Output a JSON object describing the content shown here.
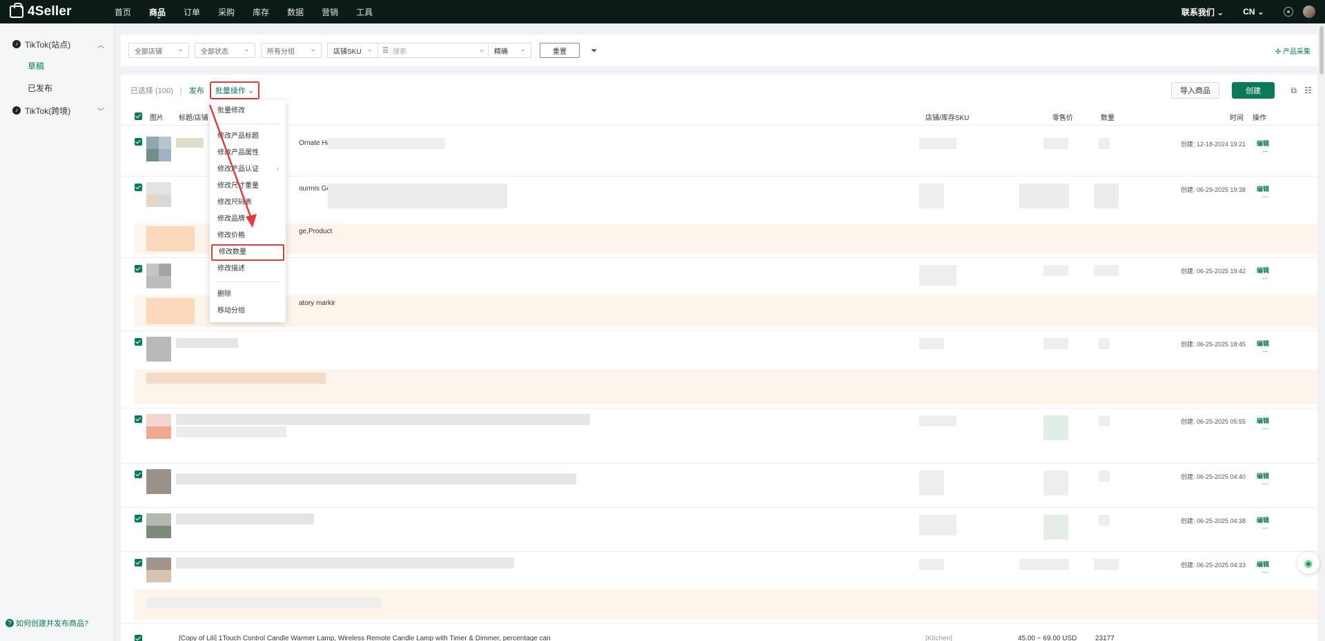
{
  "app": {
    "brand": "4Seller",
    "accent": "#0b7a5b",
    "highlight": "#e5393b"
  },
  "nav": {
    "items": [
      {
        "label": "首页"
      },
      {
        "label": "商品"
      },
      {
        "label": "订单"
      },
      {
        "label": "采购"
      },
      {
        "label": "库存"
      },
      {
        "label": "数据"
      },
      {
        "label": "营销"
      },
      {
        "label": "工具"
      }
    ],
    "contact": "联系我们 ⌄",
    "lang": "CN ⌄"
  },
  "sidebar": {
    "group1": "TikTok(站点)",
    "sub_draft": "草稿",
    "sub_published": "已发布",
    "group2": "TikTok(跨境)",
    "help": "如何创建并发布商品?"
  },
  "filters": {
    "store": "全部店铺",
    "status": "全部状态",
    "group": "所有分组",
    "sku_type": "店铺SKU",
    "search_placeholder": "搜索",
    "match": "精确",
    "reset": "重置",
    "collect": "产品采集"
  },
  "toolbar": {
    "selected": "已选择 (100)",
    "sep": "|",
    "publish": "发布",
    "batch": "批量操作 ⌄",
    "import": "导入商品",
    "create": "创建"
  },
  "table": {
    "headers": {
      "image": "图片",
      "title": "标题/店铺",
      "sku": "店铺/库存SKU",
      "price": "零售价",
      "qty": "数量",
      "time": "时间",
      "action": "操作"
    },
    "rows": [
      {
        "frag": "Ornate Hal",
        "created": "创建: 12-18-2024 19:21"
      },
      {
        "frag": "ourmis Gel",
        "frag2": "ge,Product",
        "created": "创建: 06-29-2025 19:38"
      },
      {
        "frag": "atory markir",
        "created": "创建: 06-25-2025 19:42"
      },
      {
        "frag": "",
        "created": "创建: 06-25-2025 18:45"
      },
      {
        "frag": "",
        "created": "创建: 06-25-2025 05:55"
      },
      {
        "frag": "",
        "created": "创建: 06-25-2025 04:40"
      },
      {
        "frag": "",
        "created": "创建: 06-25-2025 04:38"
      },
      {
        "frag": "",
        "created": "创建: 06-25-2025 04:33"
      }
    ],
    "edit": "编辑",
    "more": "...",
    "last_row_title": "[Copy of Lili] 1Touch Control Candle Warmer Lamp, Wireless Remote Candle Lamp with Timer & Dimmer, percentage can",
    "last_row_sku": "[Kitchen]",
    "last_row_price": "45.00 ~ 69.00 USD",
    "last_row_qty": "23177"
  },
  "dropdown": {
    "items": [
      "批量修改",
      "修改产品标题",
      "修改产品属性",
      "修改产品认证",
      "修改尺寸重量",
      "修改尺码表",
      "修改品牌",
      "修改价格",
      "修改数量",
      "修改描述",
      "删除",
      "移动分组"
    ]
  }
}
